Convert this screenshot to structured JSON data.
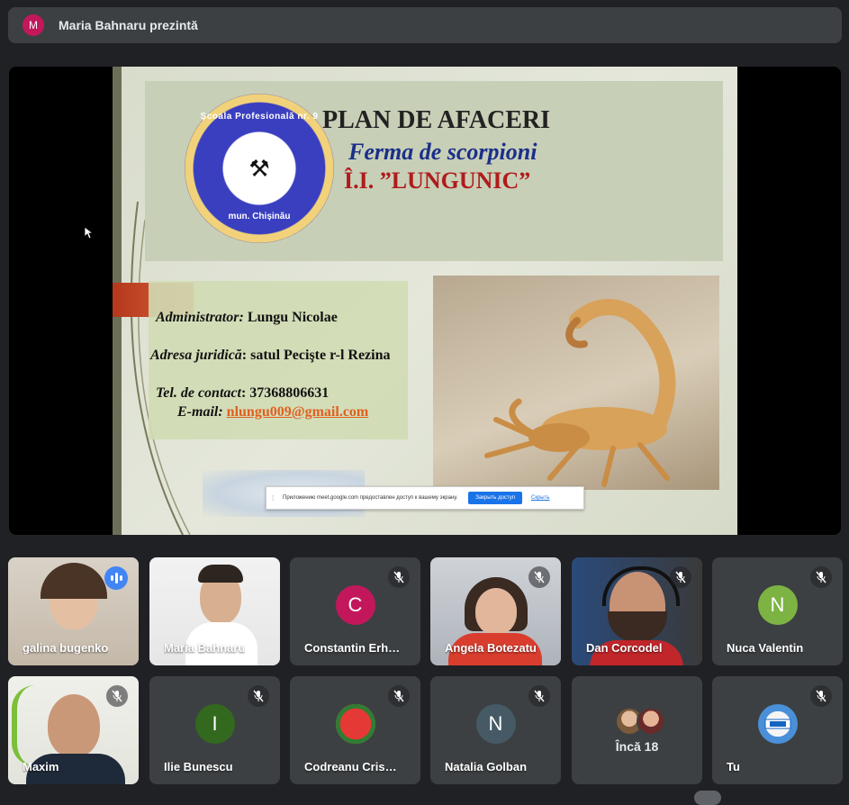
{
  "presenter": {
    "avatar_letter": "M",
    "text": "Maria Bahnaru prezintă"
  },
  "slide": {
    "logo_top_text": "Școala Profesională nr. 9",
    "logo_bottom_text": "mun. Chișinău",
    "title": "PLAN DE AFACERI",
    "subtitle": "Ferma de scorpioni",
    "company": "Î.I. ”LUNGUNIC”",
    "admin_label": "Administrator:",
    "admin_value": " Lungu Nicolae",
    "address_label": "Adresa juridică",
    "address_value": ": satul Pecişte r-l Rezina",
    "phone_label": "Tel. de contact",
    "phone_value": ": 37368806631",
    "email_label": "E-mail:",
    "email_value": "nlungu009@gmail.com"
  },
  "share_bar": {
    "text": "Приложению meet.google.com предоставлен доступ к вашему экрану.",
    "stop_button": "Закрыть доступ",
    "hide_link": "Скрыть"
  },
  "participants": [
    {
      "name": "galina bugenko",
      "speaking": true
    },
    {
      "name": "Maria Bahnaru"
    },
    {
      "name": "Constantin Erh…",
      "initial": "C",
      "avatar_color": "#c2185b"
    },
    {
      "name": "Angela Botezatu"
    },
    {
      "name": "Dan Corcodel"
    },
    {
      "name": "Nuca Valentin",
      "initial": "N",
      "avatar_color": "#7cb342"
    },
    {
      "name": "Maxim"
    },
    {
      "name": "Ilie Bunescu",
      "initial": "I",
      "avatar_color": "#33691e"
    },
    {
      "name": "Codreanu Cris…"
    },
    {
      "name": "Natalia Golban",
      "initial": "N",
      "avatar_color": "#455a64"
    },
    {
      "name": "Încă 18"
    },
    {
      "name": "Tu"
    }
  ],
  "colors": {
    "background": "#202124",
    "tile": "#3c4043",
    "accent": "#8ab4f8"
  }
}
